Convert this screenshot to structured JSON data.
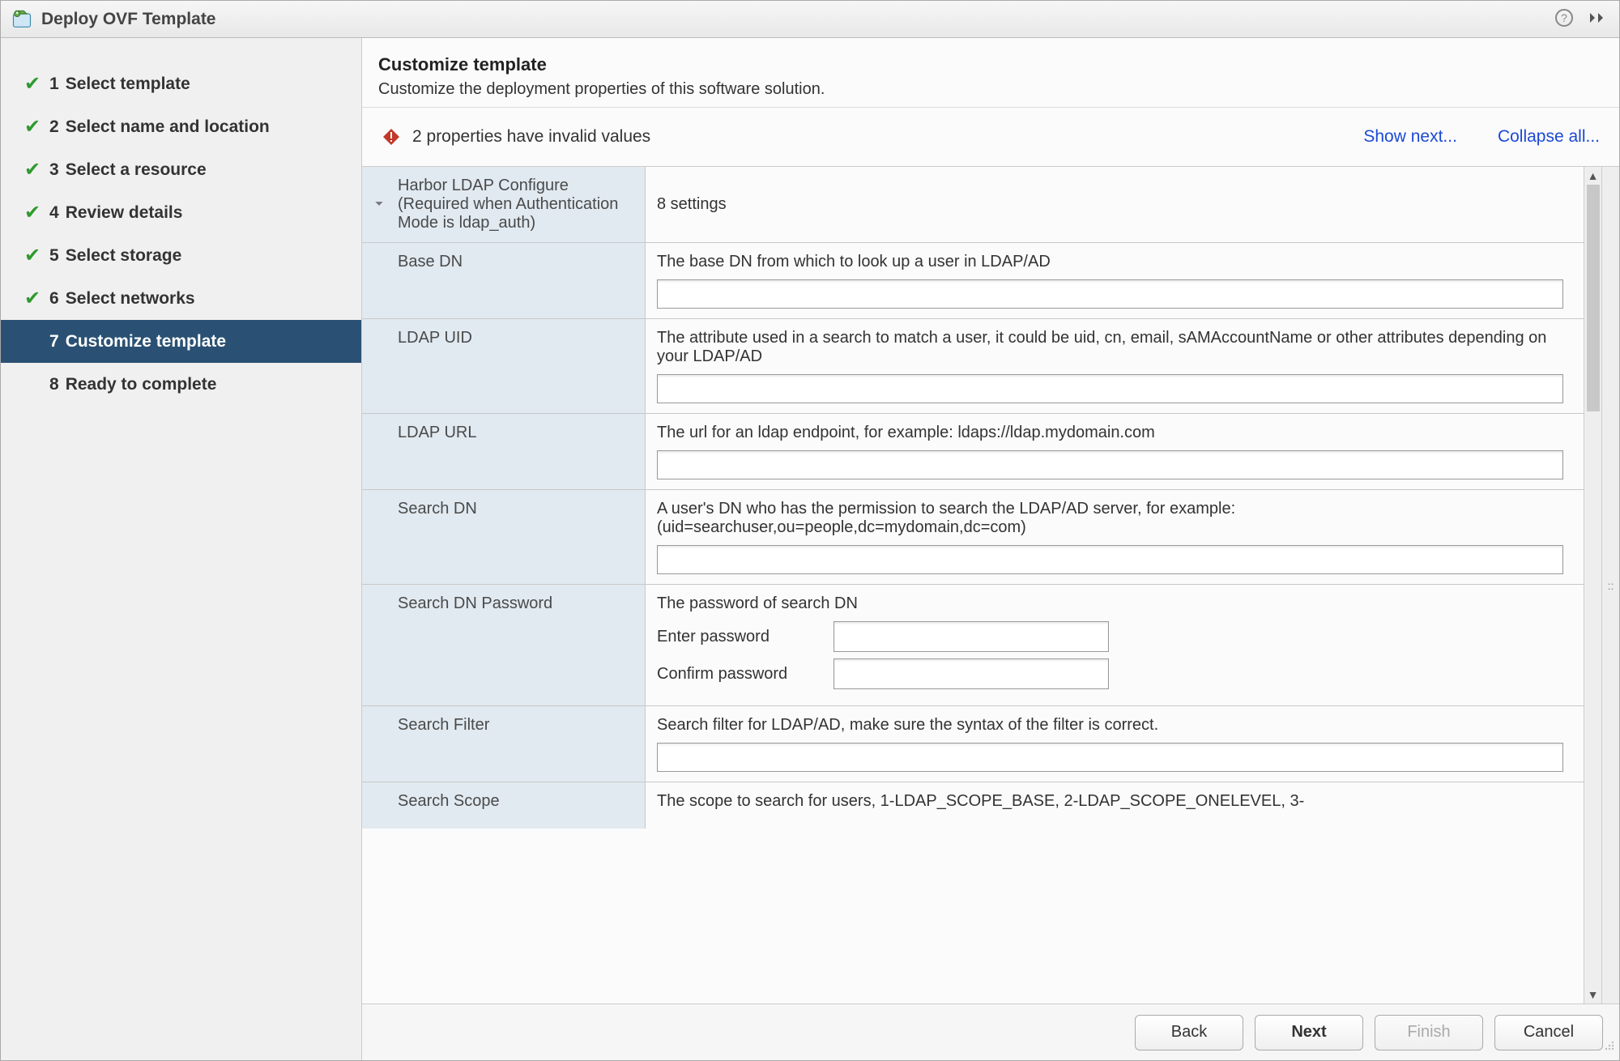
{
  "title": "Deploy OVF Template",
  "sidebar": {
    "steps": [
      {
        "num": "1",
        "label": "Select template"
      },
      {
        "num": "2",
        "label": "Select name and location"
      },
      {
        "num": "3",
        "label": "Select a resource"
      },
      {
        "num": "4",
        "label": "Review details"
      },
      {
        "num": "5",
        "label": "Select storage"
      },
      {
        "num": "6",
        "label": "Select networks"
      },
      {
        "num": "7",
        "label": "Customize template"
      },
      {
        "num": "8",
        "label": "Ready to complete"
      }
    ]
  },
  "header": {
    "title": "Customize template",
    "subtitle": "Customize the deployment properties of this software solution."
  },
  "validation": {
    "message": "2 properties have invalid values",
    "show_next_link": "Show next...",
    "collapse_all_link": "Collapse all..."
  },
  "section": {
    "label": "Harbor LDAP Configure (Required when Authentication Mode is ldap_auth)",
    "summary": "8 settings"
  },
  "settings": {
    "base_dn": {
      "label": "Base DN",
      "desc": "The base DN from which to look up a user in LDAP/AD",
      "value": ""
    },
    "ldap_uid": {
      "label": "LDAP UID",
      "desc": "The attribute used in a search to match a user, it could be uid, cn, email, sAMAccountName or other attributes depending on your LDAP/AD",
      "value": ""
    },
    "ldap_url": {
      "label": "LDAP URL",
      "desc": "The url for an ldap endpoint, for example: ldaps://ldap.mydomain.com",
      "value": ""
    },
    "search_dn": {
      "label": "Search DN",
      "desc": "A user's DN who has the permission to search the LDAP/AD server, for example: (uid=searchuser,ou=people,dc=mydomain,dc=com)",
      "value": ""
    },
    "search_dn_password": {
      "label": "Search DN Password",
      "desc": "The password of search DN",
      "enter_label": "Enter password",
      "confirm_label": "Confirm password"
    },
    "search_filter": {
      "label": "Search Filter",
      "desc": "Search filter for LDAP/AD, make sure the syntax of the filter is correct.",
      "value": ""
    },
    "search_scope": {
      "label": "Search Scope",
      "desc": "The scope to search for users, 1-LDAP_SCOPE_BASE, 2-LDAP_SCOPE_ONELEVEL, 3-"
    }
  },
  "footer": {
    "back": "Back",
    "next": "Next",
    "finish": "Finish",
    "cancel": "Cancel"
  }
}
